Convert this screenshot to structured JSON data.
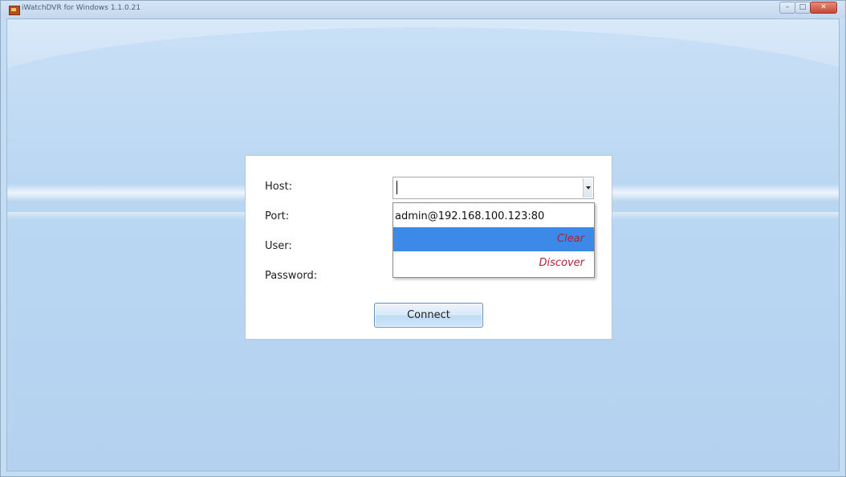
{
  "window": {
    "title": "iWatchDVR for Windows 1.1.0.21",
    "caption_buttons": {
      "minimize": "–",
      "maximize": "□",
      "close": "✕"
    }
  },
  "login": {
    "labels": {
      "host": "Host:",
      "port": "Port:",
      "user": "User:",
      "password": "Password:"
    },
    "host_value": "",
    "dropdown": {
      "entries": [
        "admin@192.168.100.123:80"
      ],
      "clear_label": "Clear",
      "discover_label": "Discover",
      "highlighted": "Clear"
    },
    "connect_label": "Connect"
  },
  "colors": {
    "background": "#c5ddf3",
    "highlight": "#3c89e8",
    "action_text": "#b0213a"
  },
  "icons": [
    "app-icon",
    "minimize-icon",
    "maximize-icon",
    "close-icon",
    "dropdown-arrow-icon"
  ]
}
